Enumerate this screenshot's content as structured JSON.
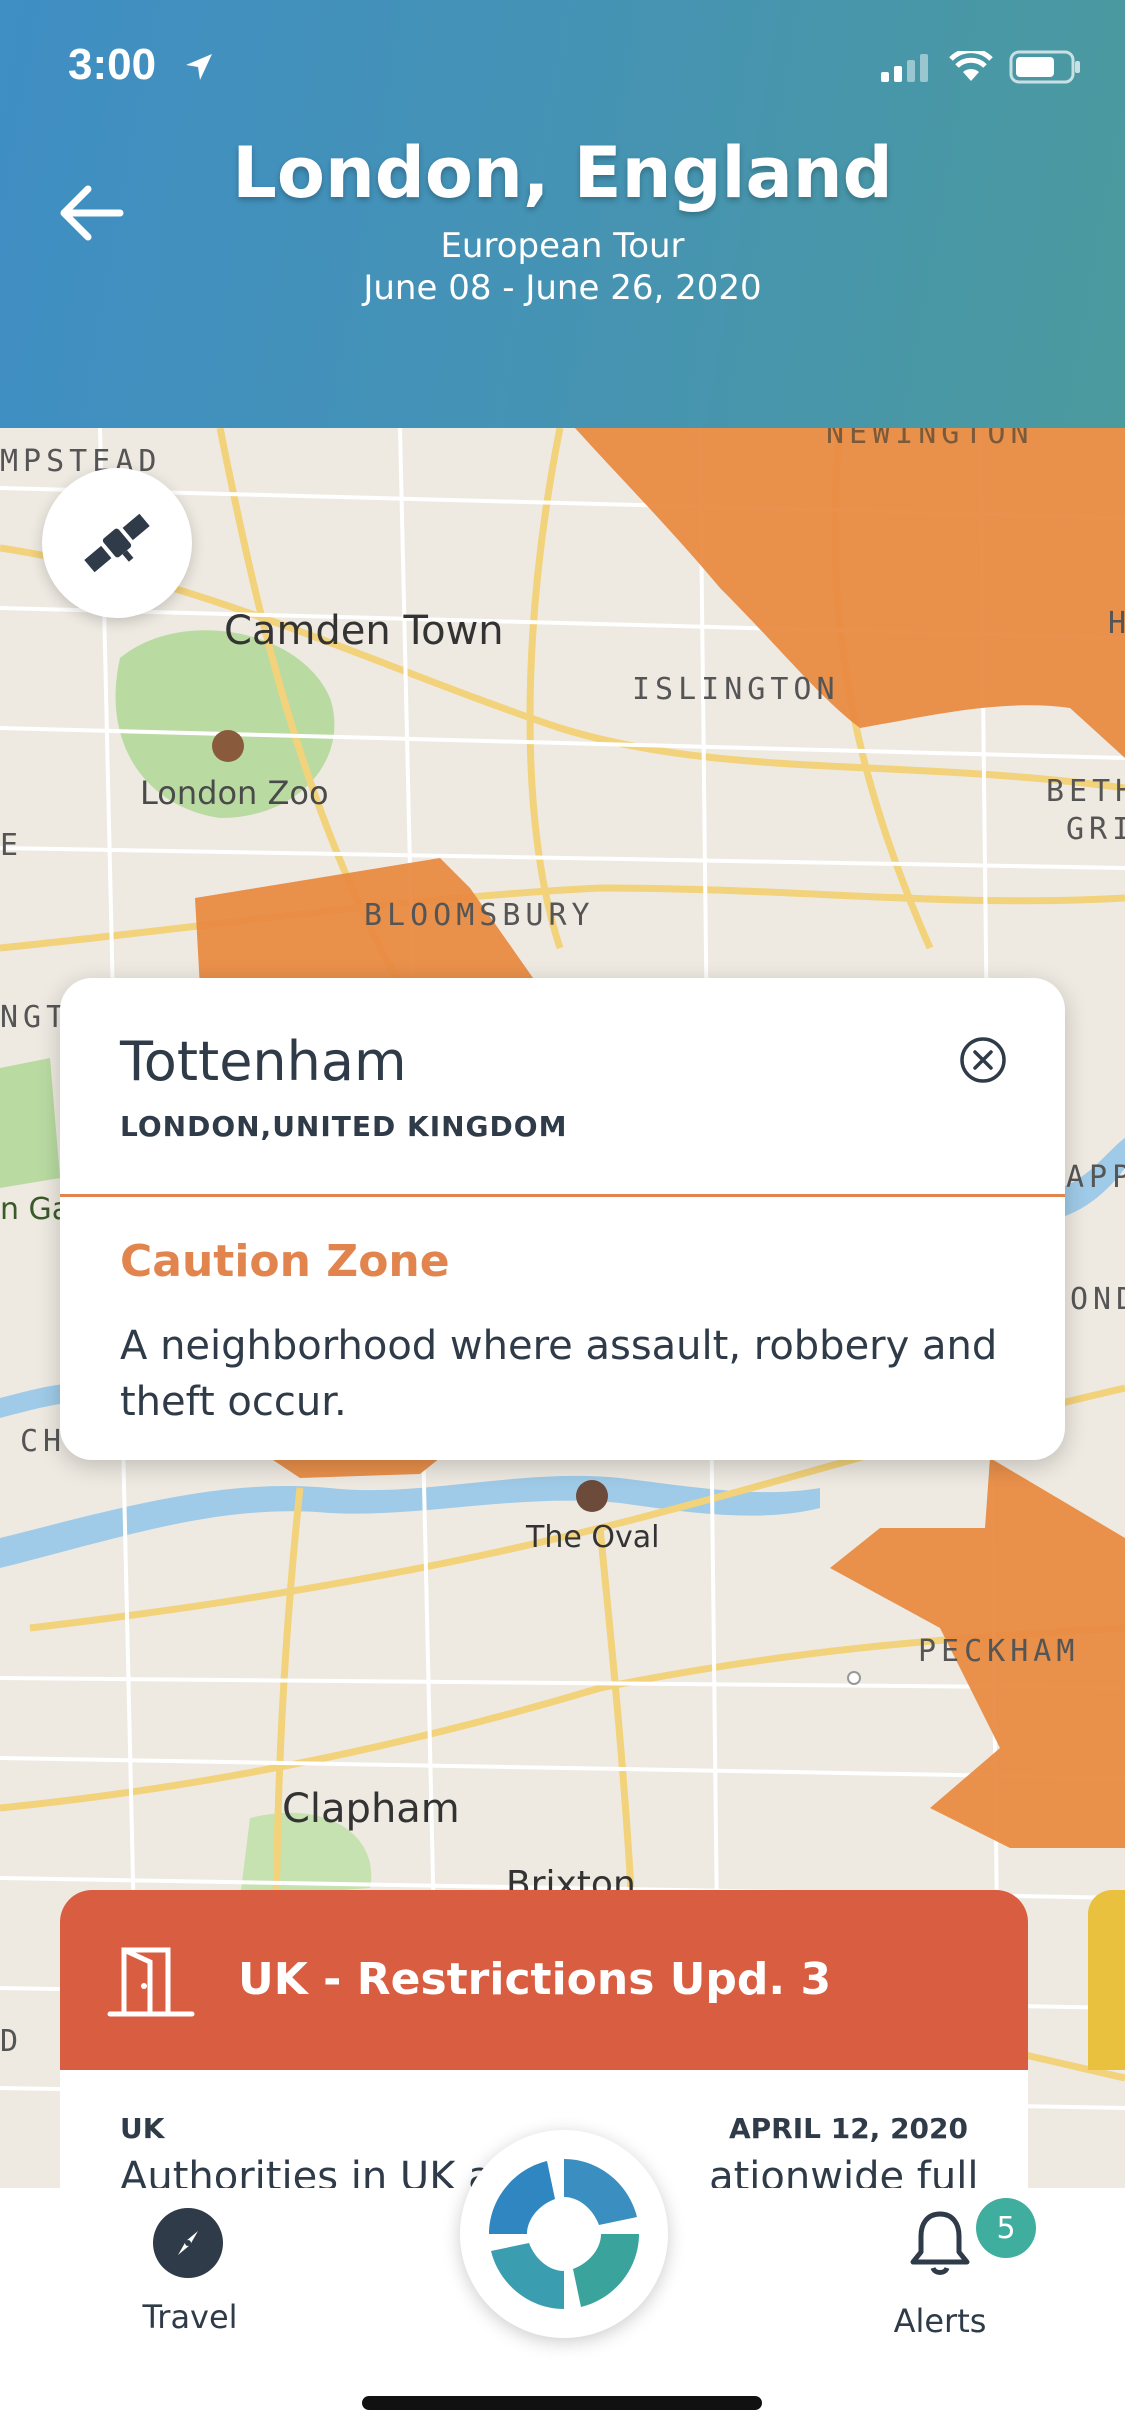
{
  "status_bar": {
    "time": "3:00"
  },
  "header": {
    "title": "London, England",
    "subtitle": "European Tour",
    "dates": "June 08 -  June 26, 2020"
  },
  "map": {
    "labels": {
      "hampstead": "MPSTEAD",
      "newington": "NEWINGTON",
      "camden_town": "Camden Town",
      "islington": "ISLINGTON",
      "london_zoo": "London Zoo",
      "bloomsbury": "BLOOMSBURY",
      "beth": "BETH",
      "gr": "GRI",
      "ngt": "NGT",
      "h_edge": "H",
      "ga": "n Ga",
      "app": "APP",
      "ond": "OND",
      "ch": "CH",
      "the_oval": "The Oval",
      "peckham": "PECKHAM",
      "clapham": "Clapham",
      "brixton": "Brixton",
      "d_edge": "D",
      "e_edge": "E"
    }
  },
  "popup": {
    "name": "Tottenham",
    "region": "LONDON,UNITED KINGDOM",
    "zone": "Caution Zone",
    "description": "A neighborhood where assault, robbery and theft occur."
  },
  "alert_card": {
    "title": "UK - Restrictions Upd. 3",
    "country": "UK",
    "date": "APRIL 12, 2020",
    "body_partial": "Authorities in UK ar",
    "body_partial_2": "ationwide full"
  },
  "nav": {
    "travel_label": "Travel",
    "alerts_label": "Alerts",
    "alerts_count": "5"
  },
  "colors": {
    "caution": "#e2844d",
    "alert_header": "#d95d40",
    "text": "#2f3b48",
    "badge": "#3fae9f"
  }
}
